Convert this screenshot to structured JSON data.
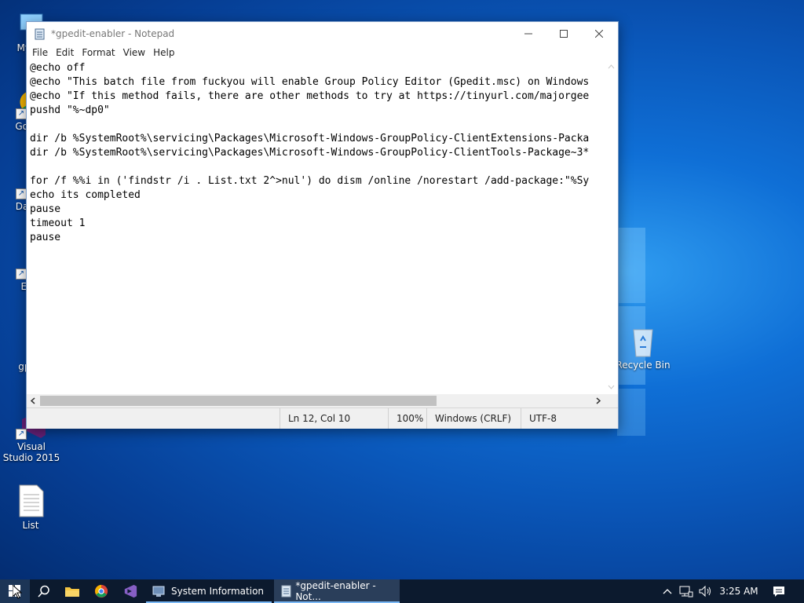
{
  "desktop": {
    "icons": [
      {
        "label": "My Co",
        "icon": "computer-icon"
      },
      {
        "label": "Go Chr",
        "icon": "chrome-icon"
      },
      {
        "label": "DataW",
        "icon": "app-shortcut-icon"
      },
      {
        "label": "Ever",
        "icon": "app-shortcut-icon"
      },
      {
        "label": "gpedi",
        "icon": "batch-file-icon"
      },
      {
        "label": "Visual Studio 2015",
        "icon": "visual-studio-icon"
      },
      {
        "label": "List",
        "icon": "text-file-icon"
      },
      {
        "label": "Recycle Bin",
        "icon": "recycle-bin-icon"
      }
    ]
  },
  "notepad": {
    "title": "*gpedit-enabler - Notepad",
    "menu": [
      "File",
      "Edit",
      "Format",
      "View",
      "Help"
    ],
    "lines": [
      "@echo off",
      "@echo \"This batch file from fuckyou will enable Group Policy Editor (Gpedit.msc) on Windows",
      "@echo \"If this method fails, there are other methods to try at https://tinyurl.com/majorgee",
      "pushd \"%~dp0\"",
      "",
      "dir /b %SystemRoot%\\servicing\\Packages\\Microsoft-Windows-GroupPolicy-ClientExtensions-Packa",
      "dir /b %SystemRoot%\\servicing\\Packages\\Microsoft-Windows-GroupPolicy-ClientTools-Package~3*",
      "",
      "for /f %%i in ('findstr /i . List.txt 2^>nul') do dism /online /norestart /add-package:\"%Sy",
      "echo its completed",
      "pause",
      "timeout 1",
      "pause"
    ],
    "status": {
      "position": "Ln 12, Col 10",
      "zoom": "100%",
      "line_endings": "Windows (CRLF)",
      "encoding": "UTF-8"
    },
    "horizontal_scroll_fraction": 0.72
  },
  "taskbar": {
    "tasks": [
      {
        "label": "System Information",
        "icon": "system-information-icon"
      },
      {
        "label": "*gpedit-enabler - Not...",
        "icon": "notepad-icon"
      }
    ],
    "clock": "3:25 AM"
  },
  "colors": {
    "taskbar": "#0c1a2e",
    "accent": "#7ab8f5"
  }
}
